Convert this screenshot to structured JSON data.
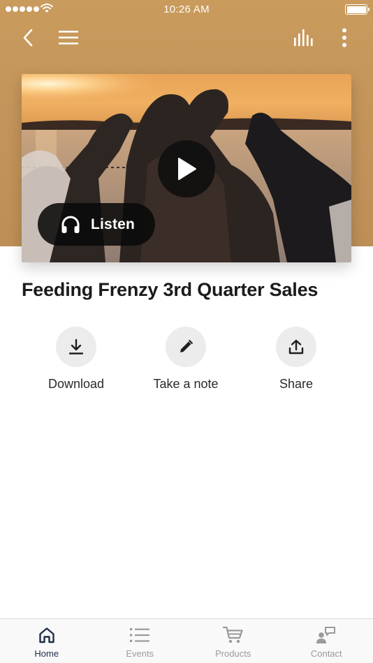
{
  "status_bar": {
    "time": "10:26 AM"
  },
  "nav": {
    "back_icon": "chevron-left-icon",
    "menu_icon": "hamburger-menu-icon",
    "equalizer_icon": "equalizer-icon",
    "more_icon": "more-vertical-icon"
  },
  "media": {
    "play_icon": "play-icon",
    "listen_label": "Listen",
    "listen_icon": "headphones-icon"
  },
  "title": "Feeding Frenzy 3rd Quarter Sales",
  "actions": [
    {
      "label": "Download",
      "icon": "download-icon"
    },
    {
      "label": "Take a note",
      "icon": "pencil-icon"
    },
    {
      "label": "Share",
      "icon": "share-icon"
    }
  ],
  "tabs": [
    {
      "label": "Home",
      "icon": "home-icon",
      "active": true
    },
    {
      "label": "Events",
      "icon": "list-icon",
      "active": false
    },
    {
      "label": "Products",
      "icon": "cart-icon",
      "active": false
    },
    {
      "label": "Contact",
      "icon": "contact-icon",
      "active": false
    }
  ],
  "colors": {
    "header_bg": "#c2935a",
    "active_tab": "#1f2d4a",
    "inactive_tab": "#9a9a9a",
    "action_circle": "#ececec"
  }
}
